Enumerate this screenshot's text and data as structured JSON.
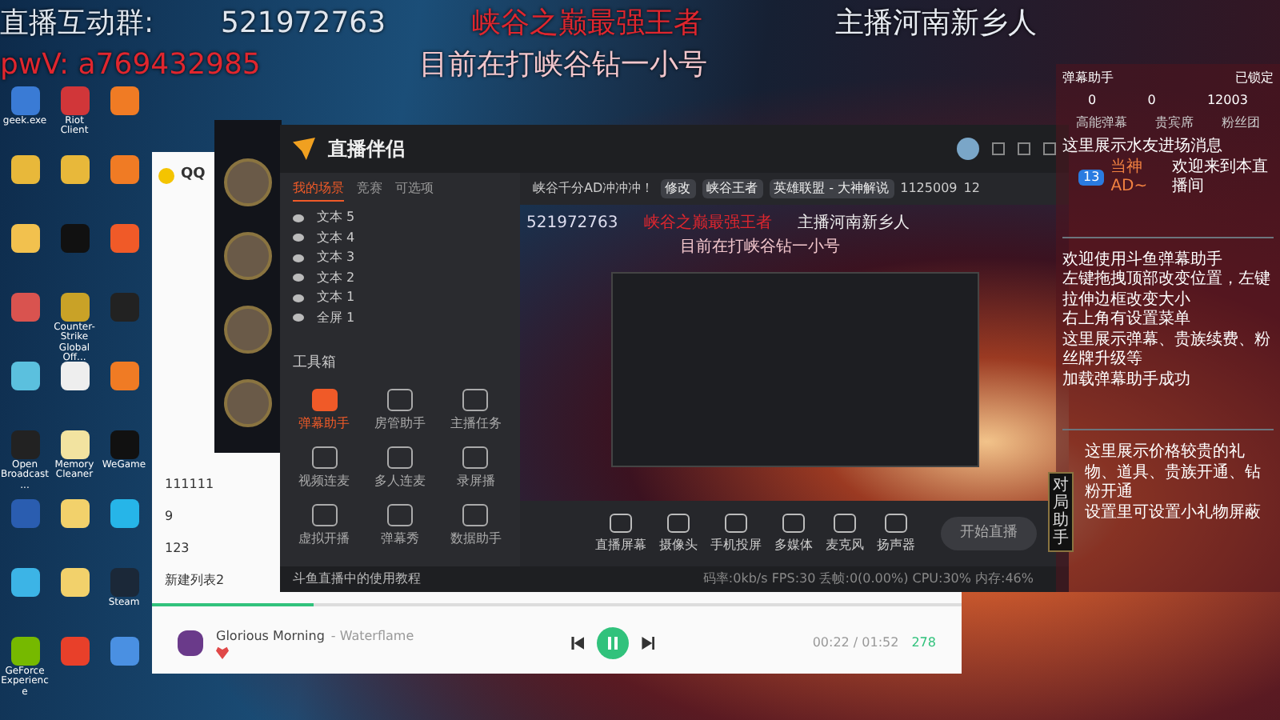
{
  "overlay": {
    "group_label": "直播互动群:",
    "group_number": "521972763",
    "headline": "峡谷之巅最强王者",
    "host": "主播河南新乡人",
    "wechat": "pwV: a769432985",
    "subline": "目前在打峡谷钻一小号"
  },
  "desktop_icons": [
    {
      "label": "geek.exe",
      "color": "#3a7bd5"
    },
    {
      "label": "Riot Client",
      "color": "#d13639"
    },
    {
      "color": "#f07b24"
    },
    {
      "color": "#e8b83a"
    },
    {
      "color": "#e8b83a"
    },
    {
      "color": "#f07b24"
    },
    {
      "color": "#f2c14e"
    },
    {
      "color": "#111111"
    },
    {
      "color": "#f05a28"
    },
    {
      "color": "#d9534f"
    },
    {
      "label": "Counter-Strike Global Off...",
      "color": "#c9a227"
    },
    {
      "color": "#222222"
    },
    {
      "color": "#5bc0de"
    },
    {
      "color": "#eeeeee"
    },
    {
      "color": "#f07b24"
    },
    {
      "label": "Open Broadcast...",
      "color": "#222222"
    },
    {
      "label": "Memory Cleaner",
      "color": "#f2e3a0"
    },
    {
      "label": "WeGame",
      "color": "#111111"
    },
    {
      "color": "#2a5db0"
    },
    {
      "color": "#f2d16b"
    },
    {
      "color": "#26b5e8"
    },
    {
      "color": "#3cb4e6"
    },
    {
      "color": "#f2d16b"
    },
    {
      "label": "Steam",
      "color": "#1b2838"
    },
    {
      "label": "GeForce Experience",
      "color": "#76b900"
    },
    {
      "color": "#e8402a"
    },
    {
      "color": "#4a90e2"
    }
  ],
  "music_window": {
    "title": "QQ",
    "playlists": [
      "111111",
      "9",
      "123",
      "新建列表2"
    ],
    "player": {
      "song": "Glorious Morning",
      "artist": "- Waterflame",
      "time": "00:22 / 01:52",
      "count": "278",
      "playing": true,
      "liked": true,
      "level": 0.2
    }
  },
  "stream_app": {
    "logo": "直播伴侣",
    "scene_tabs": [
      {
        "label": "我的场景",
        "selected": true
      },
      {
        "label": "竞赛",
        "selected": false
      },
      {
        "label": "可选项",
        "selected": false
      }
    ],
    "sources": [
      {
        "label": "文本 5",
        "visible": true
      },
      {
        "label": "文本 4",
        "visible": true
      },
      {
        "label": "文本 3",
        "visible": true
      },
      {
        "label": "文本 2",
        "visible": true
      },
      {
        "label": "文本 1",
        "visible": true
      },
      {
        "label": "全屏 1",
        "visible": true
      }
    ],
    "toolbox_title": "工具箱",
    "tools": [
      {
        "label": "弹幕助手",
        "active": true
      },
      {
        "label": "房管助手",
        "active": false
      },
      {
        "label": "主播任务",
        "active": false
      },
      {
        "label": "视频连麦",
        "active": false
      },
      {
        "label": "多人连麦",
        "active": false
      },
      {
        "label": "录屏播",
        "active": false
      },
      {
        "label": "虚拟开播",
        "active": false
      },
      {
        "label": "弹幕秀",
        "active": false
      },
      {
        "label": "数据助手",
        "active": false
      }
    ],
    "room_title": "峡谷千分AD冲冲冲！",
    "edit_label": "修改",
    "notice": "峡谷王者",
    "category": "英雄联盟 - 大神解说",
    "room_id": "1125009",
    "fans": "12",
    "preview": {
      "group_number": "521972763",
      "headline": "峡谷之巅最强王者",
      "host": "主播河南新乡人",
      "subline": "目前在打峡谷钻一小号"
    },
    "sources_bar": [
      "直播屏幕",
      "摄像头",
      "手机投屏",
      "多媒体",
      "麦克风",
      "扬声器"
    ],
    "start_button": "开始直播",
    "tutorial": "斗鱼直播中的使用教程",
    "stats": "码率:0kb/s  FPS:30  丢帧:0(0.00%)  CPU:30%  内存:46%"
  },
  "side_tab": "对局助手",
  "danmu_panel": {
    "title": "弹幕助手",
    "lock": "已锁定",
    "counts": [
      "0",
      "0",
      "12003"
    ],
    "tabs": [
      "高能弹幕",
      "贵宾席",
      "粉丝团"
    ],
    "enter_notice": "这里展示水友进场消息",
    "user_level": "13",
    "user_name": "当神AD~",
    "welcome": "欢迎来到本直播间",
    "messages": [
      "欢迎使用斗鱼弹幕助手",
      "左键拖拽顶部改变位置，左键拉伸边框改变大小",
      "右上角有设置菜单",
      "这里展示弹幕、贵族续费、粉丝牌升级等",
      "加载弹幕助手成功"
    ],
    "gift_messages": [
      "这里展示价格较贵的礼物、道具、贵族开通、钻粉开通",
      "设置里可设置小礼物屏蔽"
    ]
  }
}
